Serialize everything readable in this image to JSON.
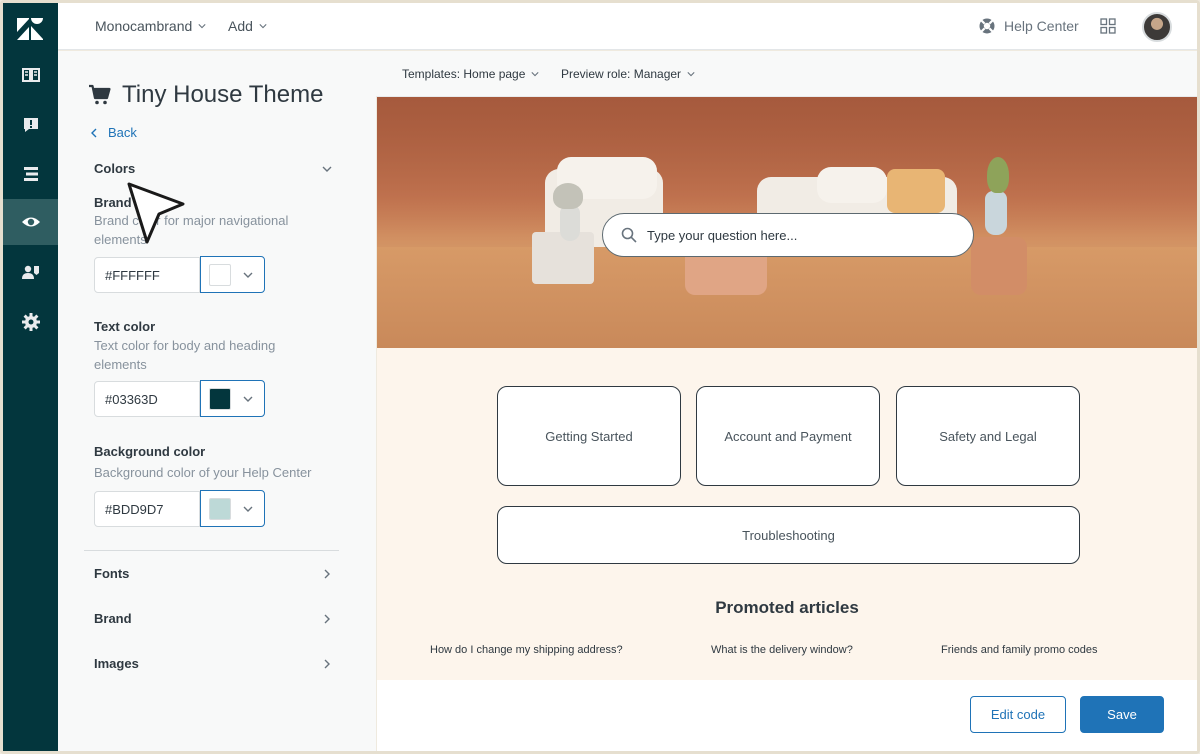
{
  "topbar": {
    "brand_menu": "Monocambrand",
    "add_menu": "Add",
    "help_center": "Help Center"
  },
  "rail": {
    "items": [
      {
        "icon": "book-icon"
      },
      {
        "icon": "alert-icon"
      },
      {
        "icon": "list-icon"
      },
      {
        "icon": "eye-icon",
        "active": true
      },
      {
        "icon": "users-icon"
      },
      {
        "icon": "gear-icon"
      }
    ]
  },
  "panel": {
    "title": "Tiny House Theme",
    "back_label": "Back",
    "colors_section": "Colors",
    "brand_color": {
      "label": "Brand",
      "desc": "Brand color for major navigational elements",
      "value": "#FFFFFF",
      "swatch": "#FFFFFF"
    },
    "text_color": {
      "label": "Text color",
      "desc": "Text color for body and heading elements",
      "value": "#03363D",
      "swatch": "#03363D"
    },
    "background_color": {
      "label": "Background color",
      "desc": "Background color of your Help Center",
      "value": "#BDD9D7",
      "swatch": "#BDD9D7"
    },
    "fonts_section": "Fonts",
    "brand_section": "Brand",
    "images_section": "Images"
  },
  "preview": {
    "template_menu": "Templates: Home page",
    "role_menu": "Preview role: Manager",
    "search_placeholder": "Type your question here...",
    "categories": [
      "Getting Started",
      "Account and Payment",
      "Safety and Legal",
      "Troubleshooting"
    ],
    "promoted_title": "Promoted articles",
    "promoted_articles": [
      "How do I change my shipping address?",
      "What is the delivery window?",
      "Friends and family promo codes"
    ]
  },
  "footer": {
    "edit_code": "Edit code",
    "save": "Save"
  },
  "colors": {
    "rail_bg": "#03363D",
    "accent": "#1F73B7"
  }
}
